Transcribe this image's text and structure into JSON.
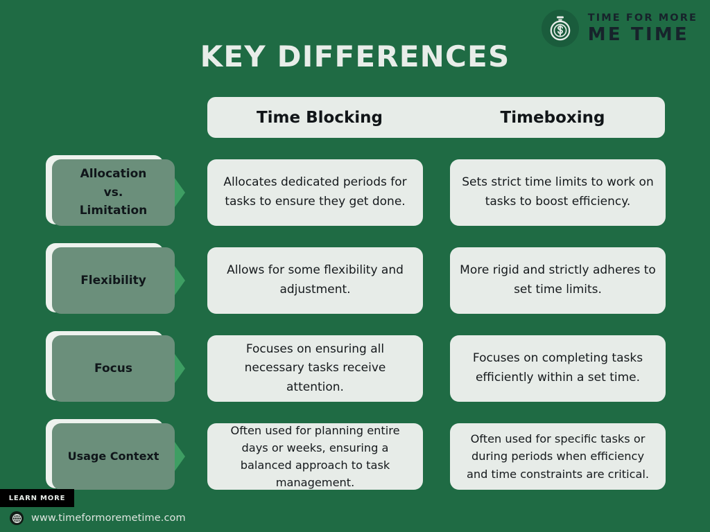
{
  "brand": {
    "logo_icon": "stopwatch-dollar-icon",
    "tagline": "TIME FOR MORE",
    "name": "ME TIME"
  },
  "page": {
    "title": "KEY DIFFERENCES",
    "background_color": "#1f6b44",
    "card_color": "#e7ece8",
    "label_box_color": "#6b8f7b",
    "arrow_color": "#3e9e63",
    "text_color": "#15191c"
  },
  "table": {
    "columns": [
      {
        "label": "Time Blocking"
      },
      {
        "label": "Timeboxing"
      }
    ],
    "rows": [
      {
        "label": "Allocation\nvs.\nLimitation",
        "label_lines": [
          "Allocation",
          "vs.",
          "Limitation"
        ],
        "time_blocking": "Allocates dedicated periods for tasks to ensure they get done.",
        "timeboxing": "Sets strict time limits to work on tasks to boost efficiency."
      },
      {
        "label": "Flexibility",
        "label_lines": [
          "Flexibility"
        ],
        "time_blocking": "Allows for some flexibility and adjustment.",
        "timeboxing": "More rigid and strictly adheres to set time limits."
      },
      {
        "label": "Focus",
        "label_lines": [
          "Focus"
        ],
        "time_blocking": "Focuses on ensuring all necessary tasks receive attention.",
        "timeboxing": "Focuses on completing tasks efficiently within a set time."
      },
      {
        "label": "Usage Context",
        "label_lines": [
          "Usage Context"
        ],
        "time_blocking": "Often used for planning entire days or weeks, ensuring a balanced approach to task management.",
        "timeboxing": "Often used for specific tasks or during periods when efficiency and time constraints are critical."
      }
    ]
  },
  "footer": {
    "cta_label": "LEARN MORE",
    "globe_icon": "globe-icon",
    "website": "www.timeformoremetime.com"
  }
}
